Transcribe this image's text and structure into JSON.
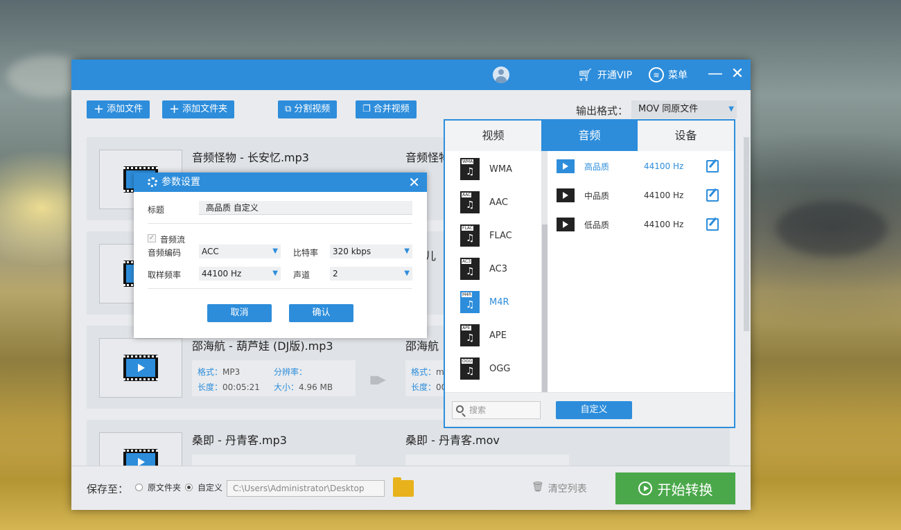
{
  "titlebar": {
    "username": "",
    "vip_label": "开通VIP",
    "menu_label": "菜单"
  },
  "toolbar": {
    "add_file": "添加文件",
    "add_folder": "添加文件夹",
    "split_video": "分割视频",
    "merge_video": "合并视频",
    "output_format_label": "输出格式：",
    "output_format_value": "MOV  同原文件"
  },
  "files": [
    {
      "name": "音频怪物 - 长安忆.mp3",
      "output_name": "音频怪物"
    },
    {
      "name": "",
      "output_name": "儿"
    },
    {
      "name": "邵海航 - 葫芦娃 (DJ版).mp3",
      "output_name": "邵海航",
      "format_key": "格式：",
      "format_val": "MP3",
      "resolution_key": "分辨率：",
      "duration_key": "长度：",
      "duration_val": "00:05:21",
      "size_key": "大小：",
      "size_val": "4.96 MB",
      "out_format_key": "格式：",
      "out_format_val": "m",
      "out_duration_key": "长度：",
      "out_duration_val": "00"
    },
    {
      "name": "桑即 - 丹青客.mp3",
      "output_name": "桑即 - 丹青客.mov"
    }
  ],
  "bottom": {
    "save_to": "保存至：",
    "opt_source": "原文件夹",
    "opt_custom": "自定义",
    "path": "C:\\Users\\Administrator\\Desktop",
    "clear_list": "清空列表",
    "start": "开始转换"
  },
  "format_panel": {
    "tabs": [
      "视频",
      "音频",
      "设备"
    ],
    "active_tab": "音频",
    "formats": [
      "WMA",
      "AAC",
      "FLAC",
      "AC3",
      "M4R",
      "APE",
      "OGG"
    ],
    "selected_format": "M4R",
    "qualities": [
      {
        "label": "高品质",
        "hz": "44100 Hz"
      },
      {
        "label": "中品质",
        "hz": "44100 Hz"
      },
      {
        "label": "低品质",
        "hz": "44100 Hz"
      }
    ],
    "search_placeholder": "搜索",
    "custom_button": "自定义"
  },
  "dialog": {
    "title": "参数设置",
    "title_label": "标题",
    "title_value": "高品质 自定义",
    "audio_stream": "音频流",
    "codec_label": "音频编码",
    "codec_value": "ACC",
    "bitrate_label": "比特率",
    "bitrate_value": "320 kbps",
    "samplerate_label": "取样频率",
    "samplerate_value": "44100 Hz",
    "channel_label": "声道",
    "channel_value": "2",
    "cancel": "取消",
    "confirm": "确认"
  },
  "colors": {
    "accent": "#2d8ddb",
    "start_green": "#4aa84a"
  }
}
